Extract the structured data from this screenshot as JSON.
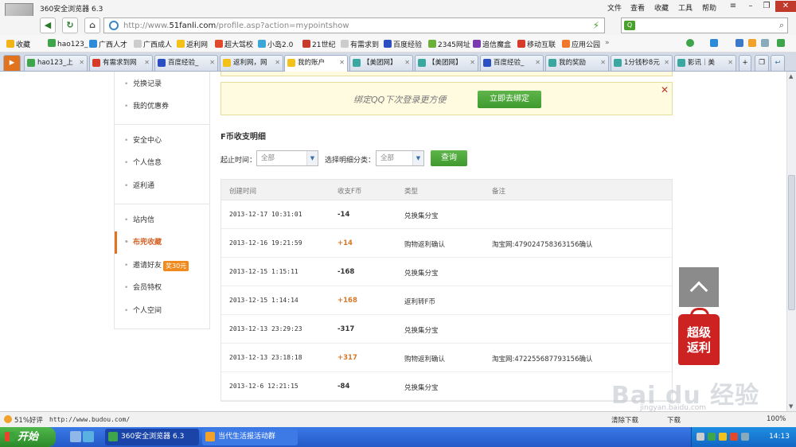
{
  "browser": {
    "title": "360安全浏览器 6.3",
    "menu": [
      "文件",
      "查看",
      "收藏",
      "工具",
      "帮助"
    ],
    "window_buttons": [
      "≡",
      "–",
      "❐",
      "✕"
    ],
    "url_prefix": "http://www.",
    "url_domain": "51fanli.com",
    "url_path": "/profile.asp?action=mypointshow",
    "search_placeholder": ""
  },
  "bookmarks": [
    "收藏",
    "hao123_",
    "广西人才",
    "广西成人",
    "返利网",
    "超大驾校",
    "小岛2.0",
    "21世纪",
    "有需求到",
    "百度经验",
    "2345网址",
    "追信魔盒",
    "移动互联",
    "应用公园"
  ],
  "tabs": [
    {
      "label": "hao123_上",
      "active": false
    },
    {
      "label": "有需求到网",
      "active": false
    },
    {
      "label": "百度经验_",
      "active": false
    },
    {
      "label": "返利网，网",
      "active": false
    },
    {
      "label": "我的账户",
      "active": true
    },
    {
      "label": "【美团网】",
      "active": false
    },
    {
      "label": "【美团网】",
      "active": false
    },
    {
      "label": "百度经验_",
      "active": false
    },
    {
      "label": "我的奖励",
      "active": false
    },
    {
      "label": "1分钱秒8元",
      "active": false
    },
    {
      "label": "影讯｜美",
      "active": false
    }
  ],
  "sidebar": {
    "items": [
      {
        "label": "兑换记录",
        "active": false
      },
      {
        "label": "我的优惠券",
        "active": false
      },
      {
        "label": "安全中心",
        "active": false
      },
      {
        "label": "个人信息",
        "active": false
      },
      {
        "label": "返利通",
        "active": false
      },
      {
        "label": "站内信",
        "active": false
      },
      {
        "label": "布兜收藏",
        "active": true
      },
      {
        "label": "邀请好友",
        "active": false
      },
      {
        "label": "会员特权",
        "active": false
      },
      {
        "label": "个人空间",
        "active": false
      }
    ],
    "invite_badge": "奖30元"
  },
  "notice": {
    "text": "绑定QQ下次登录更方便",
    "button": "立即去绑定",
    "close": "✕"
  },
  "section_title": "F币收支明细",
  "filters": {
    "date_label": "起止时间：",
    "date_value": "全部",
    "type_label": "选择明细分类：",
    "type_value": "全部",
    "query_button": "查询"
  },
  "table": {
    "headers": [
      "创建时间",
      "收支F币",
      "类型",
      "备注"
    ],
    "rows": [
      {
        "time": "2013-12-17 10:31:01",
        "amount": "-14",
        "positive": false,
        "type": "兑换集分宝",
        "note": ""
      },
      {
        "time": "2013-12-16 19:21:59",
        "amount": "+14",
        "positive": true,
        "type": "购物返利确认",
        "note": "淘宝网:479024758363156确认"
      },
      {
        "time": "2013-12-15 1:15:11",
        "amount": "-168",
        "positive": false,
        "type": "兑换集分宝",
        "note": ""
      },
      {
        "time": "2013-12-15 1:14:14",
        "amount": "+168",
        "positive": true,
        "type": "返利转F币",
        "note": ""
      },
      {
        "time": "2013-12-13 23:29:23",
        "amount": "-317",
        "positive": false,
        "type": "兑换集分宝",
        "note": ""
      },
      {
        "time": "2013-12-13 23:18:18",
        "amount": "+317",
        "positive": true,
        "type": "购物返利确认",
        "note": "淘宝网:472255687793156确认"
      },
      {
        "time": "2013-12-6 12:21:15",
        "amount": "-84",
        "positive": false,
        "type": "兑换集分宝",
        "note": ""
      }
    ]
  },
  "promo": {
    "line1": "超级",
    "line2": "返利"
  },
  "watermark": {
    "logo": "Bai du 经验",
    "sub": "jingyan.baidu.com"
  },
  "status": {
    "rating": "51%好评",
    "url": "http://www.budou.com/",
    "download": "清除下载",
    "translate": "下载",
    "zoom": "100%"
  },
  "taskbar": {
    "start": "开始",
    "tasks": [
      "360安全浏览器 6.3",
      "当代生活报活动群"
    ],
    "clock": "14:13"
  },
  "colors": {
    "accent_orange": "#e2731e",
    "green_button": "#4aa83a",
    "promo_red": "#cc2222",
    "taskbar_blue": "#2459c8"
  }
}
